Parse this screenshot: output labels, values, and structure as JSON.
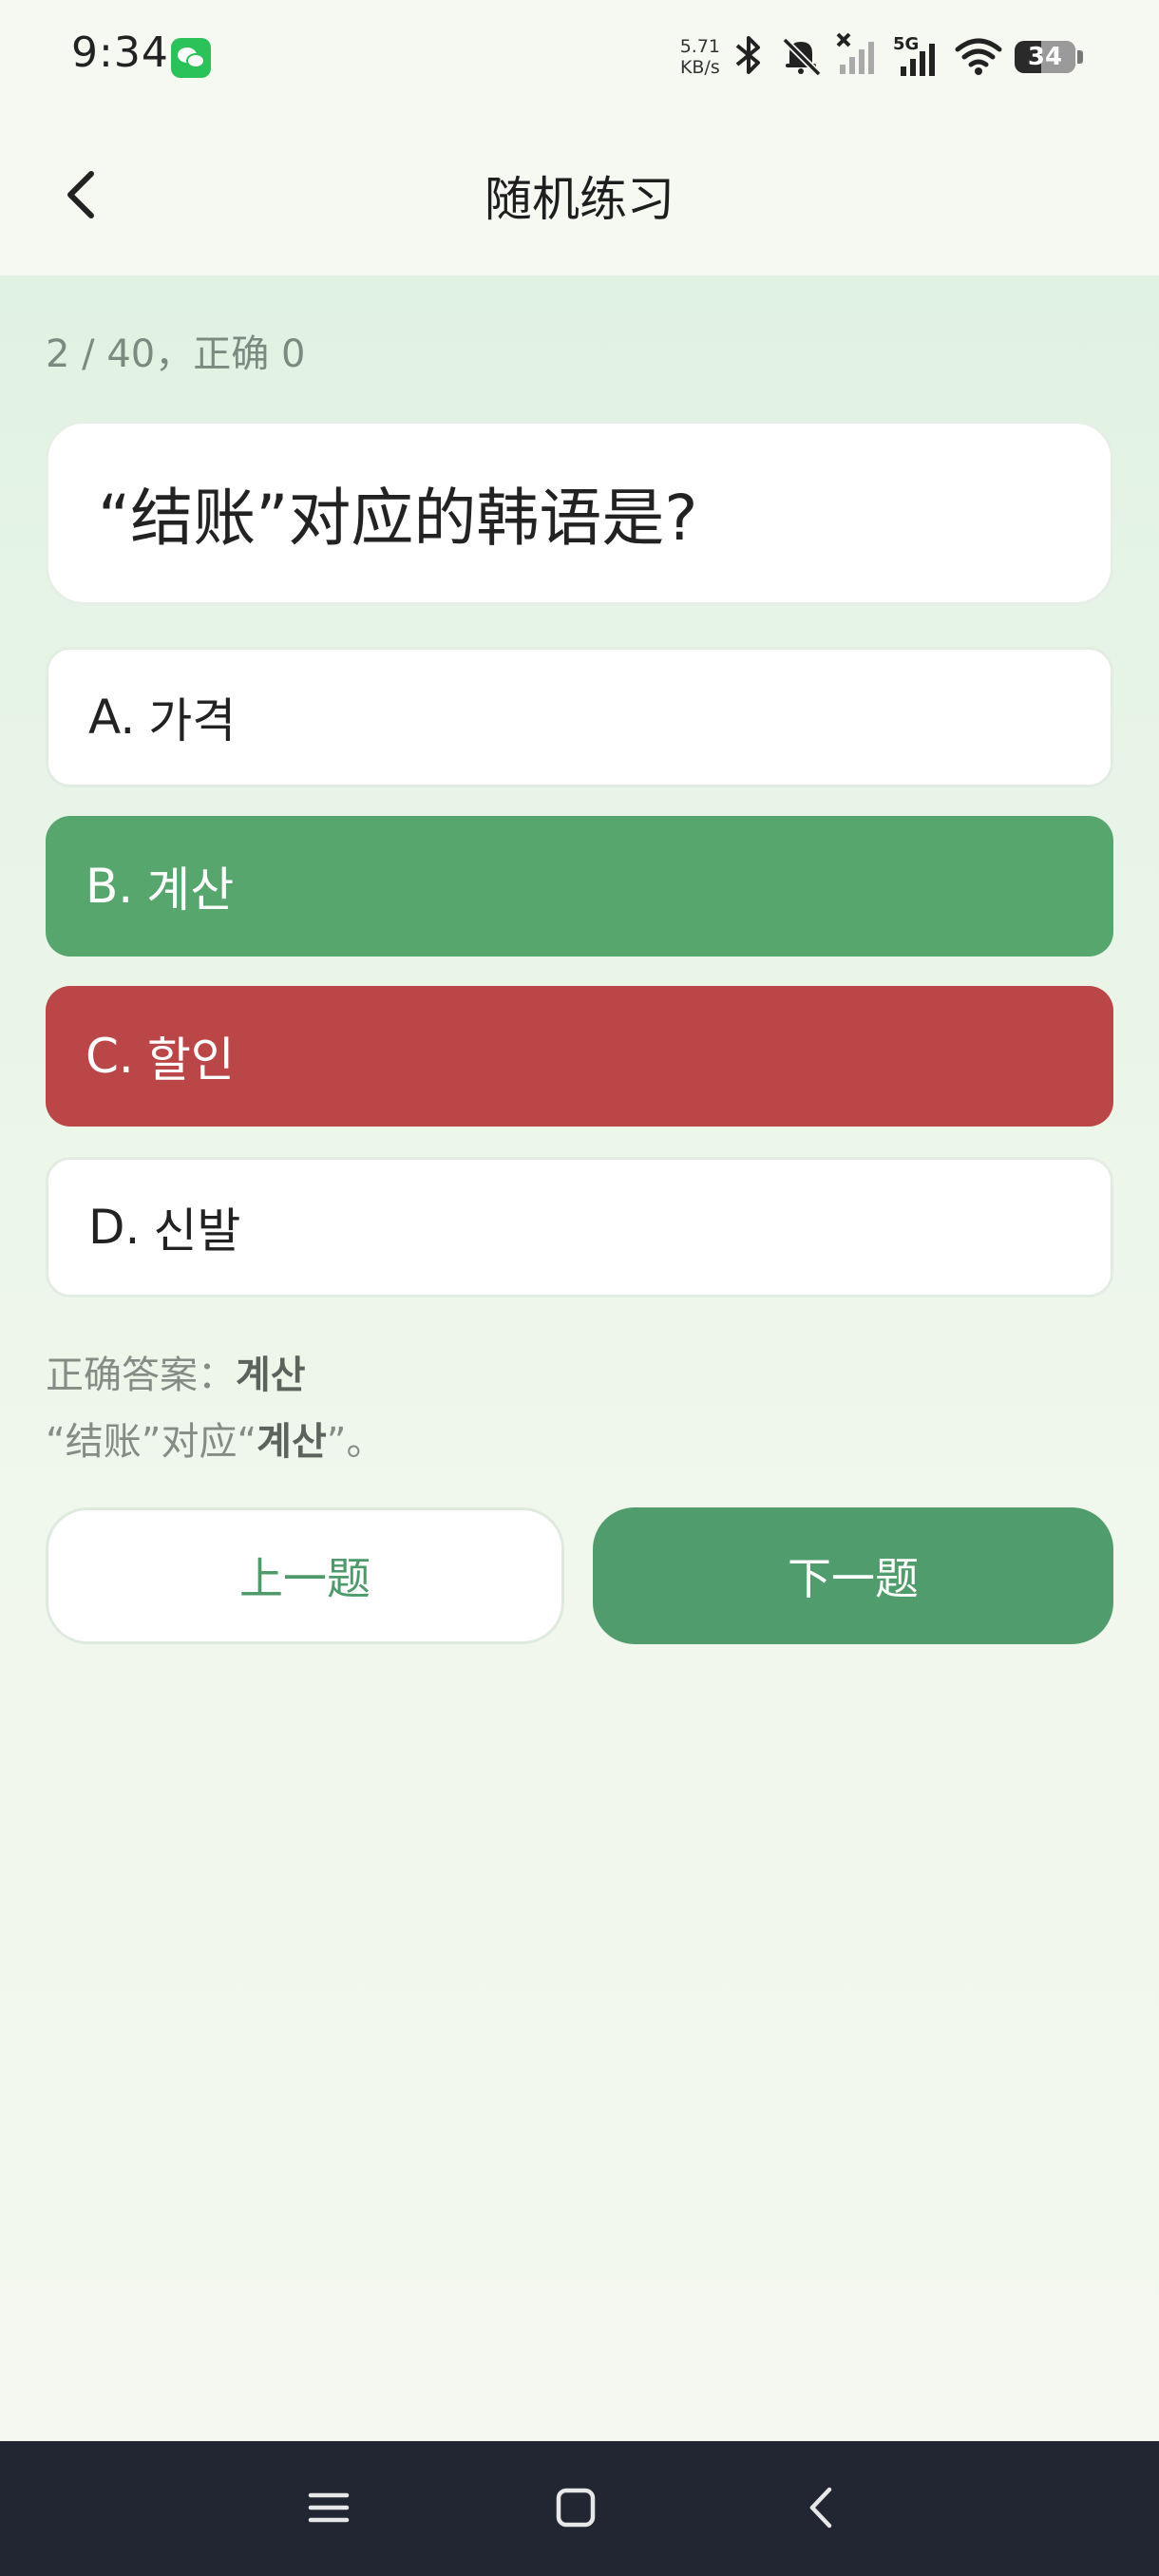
{
  "status_bar": {
    "time": "9:34",
    "net_speed_value": "5.71",
    "net_speed_unit": "KB/s",
    "network_label": "5G",
    "battery_level": "34",
    "icons": [
      "wechat-icon",
      "bluetooth-icon",
      "mute-bell-icon",
      "signal-off-icon",
      "signal-5g-icon",
      "wifi-icon",
      "battery-icon"
    ]
  },
  "header": {
    "title": "随机练习",
    "back_icon": "chevron-left-icon"
  },
  "quiz": {
    "progress": "2 / 40，正确 0",
    "question": "“结账”对应的韩语是?",
    "options": [
      {
        "letter": "A.",
        "text": "가격",
        "state": "neutral"
      },
      {
        "letter": "B.",
        "text": "계산",
        "state": "correct"
      },
      {
        "letter": "C.",
        "text": "할인",
        "state": "wrong"
      },
      {
        "letter": "D.",
        "text": "신발",
        "state": "neutral"
      }
    ],
    "answer_label": "正确答案：",
    "answer_value": "계산",
    "explain_prefix": "“结账”对应“",
    "explain_value": "계산",
    "explain_suffix": "”。"
  },
  "buttons": {
    "prev_label": "上一题",
    "next_label": "下一题"
  },
  "colors": {
    "correct": "#57a66e",
    "wrong": "#bb4647",
    "primary": "#519c6d"
  },
  "nav_bar": {
    "icons": [
      "menu-icon",
      "home-icon",
      "back-icon"
    ]
  }
}
